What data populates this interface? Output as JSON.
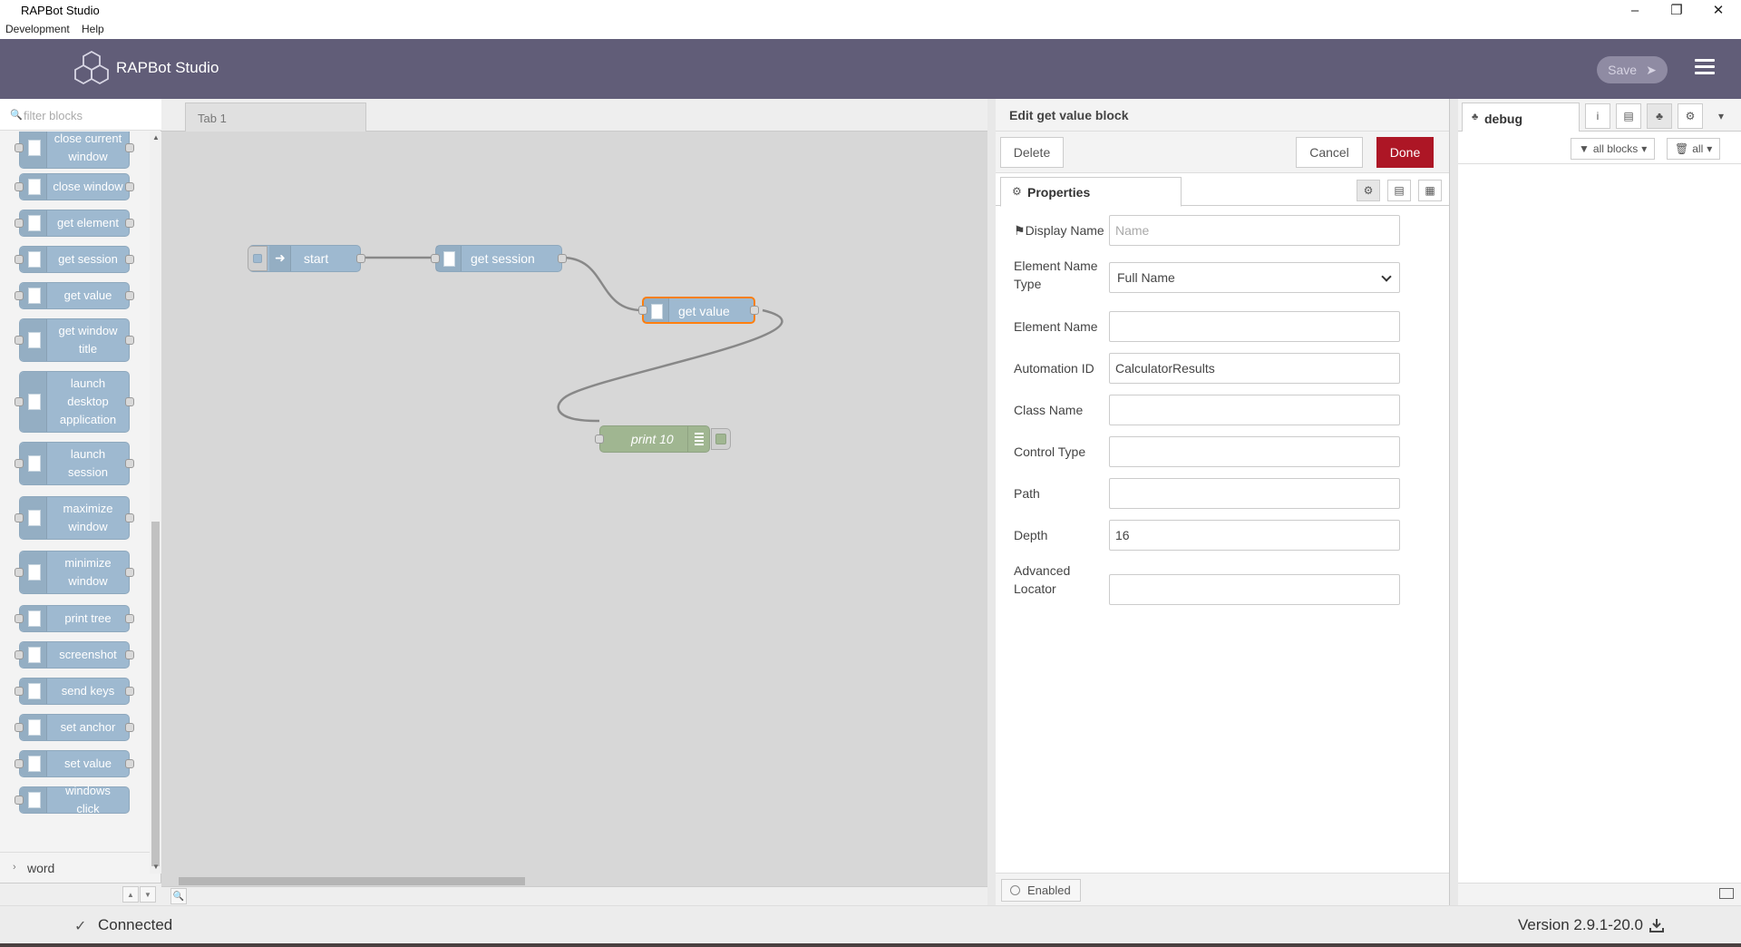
{
  "window": {
    "title": "RAPBot Studio",
    "controls": [
      "minimize-icon",
      "restore-icon",
      "close-icon"
    ]
  },
  "menu": [
    "Development",
    "Help"
  ],
  "header": {
    "app_name": "RAPBot Studio",
    "save_label": "Save",
    "colors": {
      "header_bg": "#615d78",
      "done_btn": "#ad1625",
      "node_blue": "#9eb9d0",
      "node_green": "#a0b691",
      "selected_outline": "#ff7f0e"
    }
  },
  "palette": {
    "filter_placeholder": "filter blocks",
    "nodes": [
      "close current window",
      "close window",
      "get element",
      "get session",
      "get value",
      "get window title",
      "launch desktop application",
      "launch session",
      "maximize window",
      "minimize window",
      "print tree",
      "screenshot",
      "send keys",
      "set anchor",
      "set value",
      "windows click"
    ],
    "category": "word"
  },
  "workspace": {
    "tab": "Tab 1",
    "nodes": {
      "start": "start",
      "get_session": "get session",
      "get_value": "get value",
      "print": "print 10"
    }
  },
  "editor": {
    "title": "Edit get value block",
    "delete_label": "Delete",
    "cancel_label": "Cancel",
    "done_label": "Done",
    "properties_tab": "Properties",
    "fields": {
      "display_name": {
        "label": "Display Name",
        "placeholder": "Name",
        "value": ""
      },
      "element_name_type": {
        "label_line1": "Element Name",
        "label_line2": "Type",
        "value": "Full Name"
      },
      "element_name": {
        "label": "Element Name",
        "value": ""
      },
      "automation_id": {
        "label": "Automation ID",
        "value": "CalculatorResults"
      },
      "class_name": {
        "label": "Class Name",
        "value": ""
      },
      "control_type": {
        "label": "Control Type",
        "value": ""
      },
      "path": {
        "label": "Path",
        "value": ""
      },
      "depth": {
        "label": "Depth",
        "value": "16"
      },
      "advanced_locator": {
        "label_line1": "Advanced",
        "label_line2": "Locator",
        "value": ""
      }
    },
    "enabled_label": "Enabled"
  },
  "sidebar": {
    "tab": "debug",
    "filter_nodes": "all blocks",
    "clear_filter": "all"
  },
  "status": {
    "connection": "Connected",
    "version": "Version 2.9.1-20.0"
  }
}
